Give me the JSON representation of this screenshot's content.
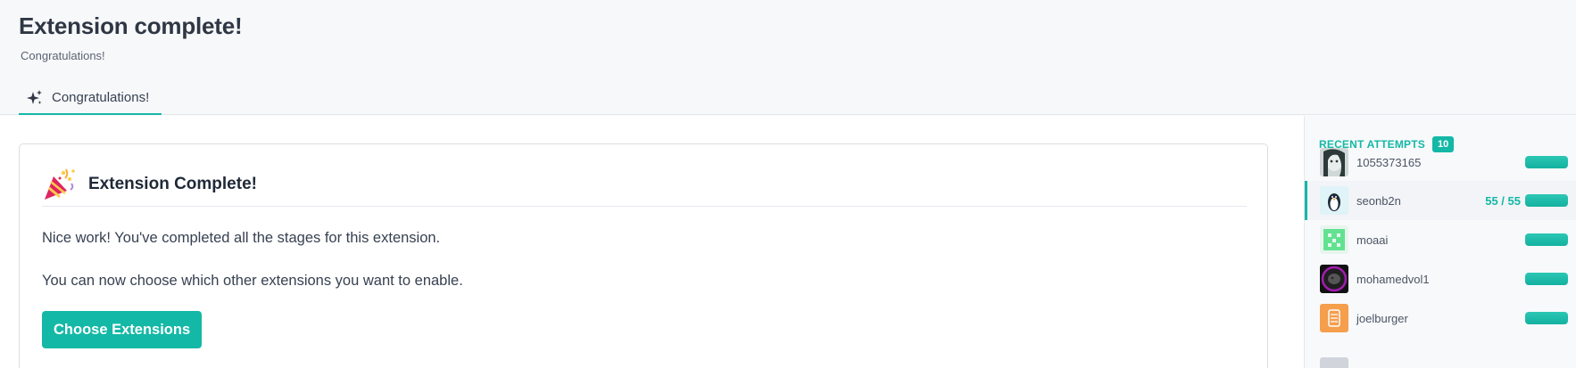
{
  "header": {
    "title": "Extension complete!",
    "subtitle": "Congratulations!",
    "tabs": [
      {
        "label": "Congratulations!",
        "icon": "sparkles-icon"
      }
    ]
  },
  "card": {
    "title": "Extension Complete!",
    "icon": "party-popper-icon",
    "message_1": "Nice work! You've completed all the stages for this extension.",
    "message_2": "You can now choose which other extensions you want to enable.",
    "button_label": "Choose Extensions"
  },
  "sidebar": {
    "title": "RECENT ATTEMPTS",
    "count": "10",
    "attempts": [
      {
        "username": "1055373165",
        "score": "",
        "progress": 1.0
      },
      {
        "username": "seonb2n",
        "score": "55 / 55",
        "progress": 1.0
      },
      {
        "username": "moaai",
        "score": "",
        "progress": 1.0
      },
      {
        "username": "mohamedvol1",
        "score": "",
        "progress": 1.0
      },
      {
        "username": "joelburger",
        "score": "",
        "progress": 1.0
      }
    ]
  },
  "colors": {
    "accent": "#14b8a6",
    "title": "#2f3744",
    "text": "#374151"
  }
}
